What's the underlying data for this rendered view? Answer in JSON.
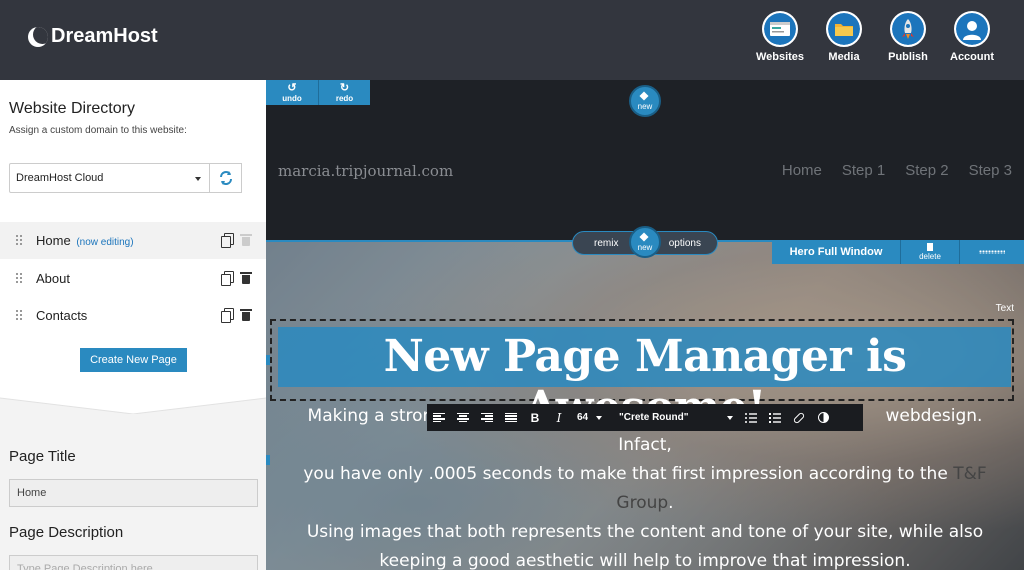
{
  "brand": {
    "name": "DreamHost"
  },
  "topnav": {
    "items": [
      {
        "label": "Websites",
        "icon": "websites-icon"
      },
      {
        "label": "Media",
        "icon": "media-icon"
      },
      {
        "label": "Publish",
        "icon": "rocket-icon"
      },
      {
        "label": "Account",
        "icon": "account-icon"
      }
    ]
  },
  "sidebar": {
    "title": "Website Directory",
    "subtitle": "Assign a custom domain to this website:",
    "domain_select": {
      "value": "DreamHost Cloud"
    },
    "pages": [
      {
        "name": "Home",
        "status": "(now editing)"
      },
      {
        "name": "About"
      },
      {
        "name": "Contacts"
      }
    ],
    "create_button": "Create New Page",
    "page_title_label": "Page Title",
    "page_title_value": "Home",
    "page_desc_label": "Page Description",
    "page_desc_placeholder": "Type Page Description here"
  },
  "editor": {
    "undo": "undo",
    "redo": "redo",
    "new_label": "new",
    "site_name": "marcia.tripjournal.com",
    "site_nav": [
      "Home",
      "Step 1",
      "Step 2",
      "Step 3"
    ],
    "remix": "remix",
    "options": "options",
    "block_name": "Hero Full Window",
    "block_delete": "delete",
    "text_tag": "Text",
    "hero_title": "New Page Manager is Awesome!",
    "hero_body_parts": [
      "Making a strong ",
      "webdesign. Infact,",
      "you have only .0005 seconds to make that first impression according to the ",
      "T&F Group",
      ".",
      "Using images that both represents the content and tone of your site, while also keeping a good aesthetic will help to improve that impression."
    ],
    "toolbar": {
      "font_size": "64",
      "font_name": "\"Crete Round\""
    }
  },
  "colors": {
    "accent": "#2a8ac0",
    "topbar": "#33363e",
    "dark": "#1e2126"
  }
}
